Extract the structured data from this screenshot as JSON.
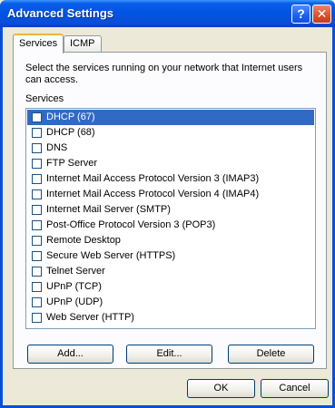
{
  "window": {
    "title": "Advanced Settings",
    "help_glyph": "?",
    "close_glyph": "✕"
  },
  "tabs": [
    {
      "label": "Services",
      "active": true
    },
    {
      "label": "ICMP",
      "active": false
    }
  ],
  "panel": {
    "description": "Select the services running on your network that Internet users can access.",
    "services_label": "Services",
    "items": [
      {
        "label": "DHCP (67)",
        "checked": false,
        "selected": true
      },
      {
        "label": "DHCP (68)",
        "checked": false,
        "selected": false
      },
      {
        "label": "DNS",
        "checked": false,
        "selected": false
      },
      {
        "label": "FTP Server",
        "checked": false,
        "selected": false
      },
      {
        "label": "Internet Mail Access Protocol Version 3 (IMAP3)",
        "checked": false,
        "selected": false
      },
      {
        "label": "Internet Mail Access Protocol Version 4 (IMAP4)",
        "checked": false,
        "selected": false
      },
      {
        "label": "Internet Mail Server (SMTP)",
        "checked": false,
        "selected": false
      },
      {
        "label": "Post-Office Protocol Version 3 (POP3)",
        "checked": false,
        "selected": false
      },
      {
        "label": "Remote Desktop",
        "checked": false,
        "selected": false
      },
      {
        "label": "Secure Web Server (HTTPS)",
        "checked": false,
        "selected": false
      },
      {
        "label": "Telnet Server",
        "checked": false,
        "selected": false
      },
      {
        "label": "UPnP (TCP)",
        "checked": false,
        "selected": false
      },
      {
        "label": "UPnP (UDP)",
        "checked": false,
        "selected": false
      },
      {
        "label": "Web Server (HTTP)",
        "checked": false,
        "selected": false
      }
    ],
    "buttons": {
      "add": "Add...",
      "edit": "Edit...",
      "delete": "Delete"
    }
  },
  "footer": {
    "ok": "OK",
    "cancel": "Cancel"
  },
  "colors": {
    "titlebar": "#0054e3",
    "selection": "#316ac5",
    "dialog_bg": "#ece9d8"
  }
}
